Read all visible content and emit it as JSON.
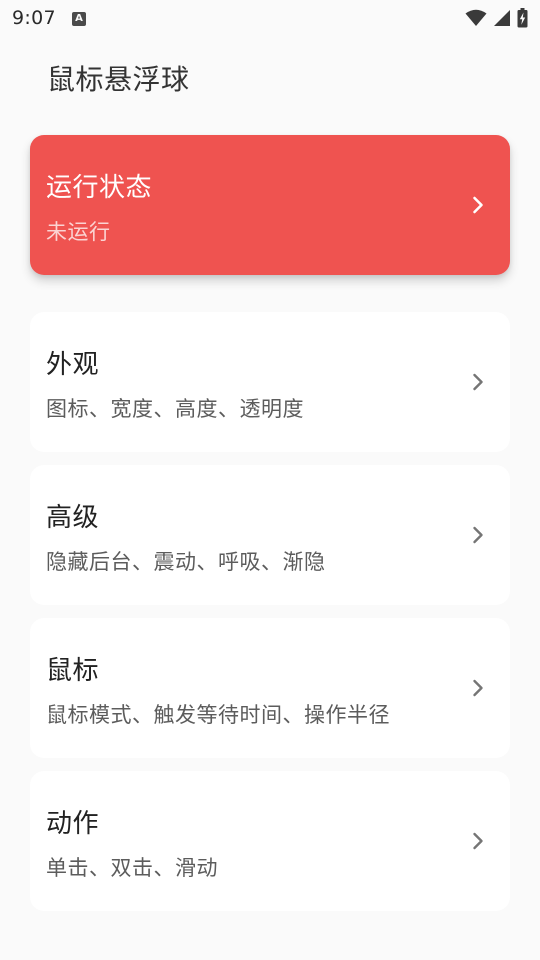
{
  "status_bar": {
    "time": "9:07",
    "notification_icon": "a-notification-icon",
    "notification_glyph": "A",
    "wifi_icon": "wifi-icon",
    "signal_icon": "cellular-signal-icon",
    "battery_icon": "battery-charging-icon"
  },
  "header": {
    "title": "鼠标悬浮球"
  },
  "cards": [
    {
      "title": "运行状态",
      "subtitle": "未运行",
      "icon": "chevron-right-icon",
      "accent": "#EF5350"
    },
    {
      "title": "外观",
      "subtitle": "图标、宽度、高度、透明度",
      "icon": "chevron-right-icon"
    },
    {
      "title": "高级",
      "subtitle": "隐藏后台、震动、呼吸、渐隐",
      "icon": "chevron-right-icon"
    },
    {
      "title": "鼠标",
      "subtitle": "鼠标模式、触发等待时间、操作半径",
      "icon": "chevron-right-icon"
    },
    {
      "title": "动作",
      "subtitle": "单击、双击、滑动",
      "icon": "chevron-right-icon"
    }
  ],
  "colors": {
    "background": "#FAFAFA",
    "card": "#FFFFFF",
    "status_accent": "#EF5350",
    "text_primary": "#222222",
    "text_secondary": "#5C5C5C"
  }
}
